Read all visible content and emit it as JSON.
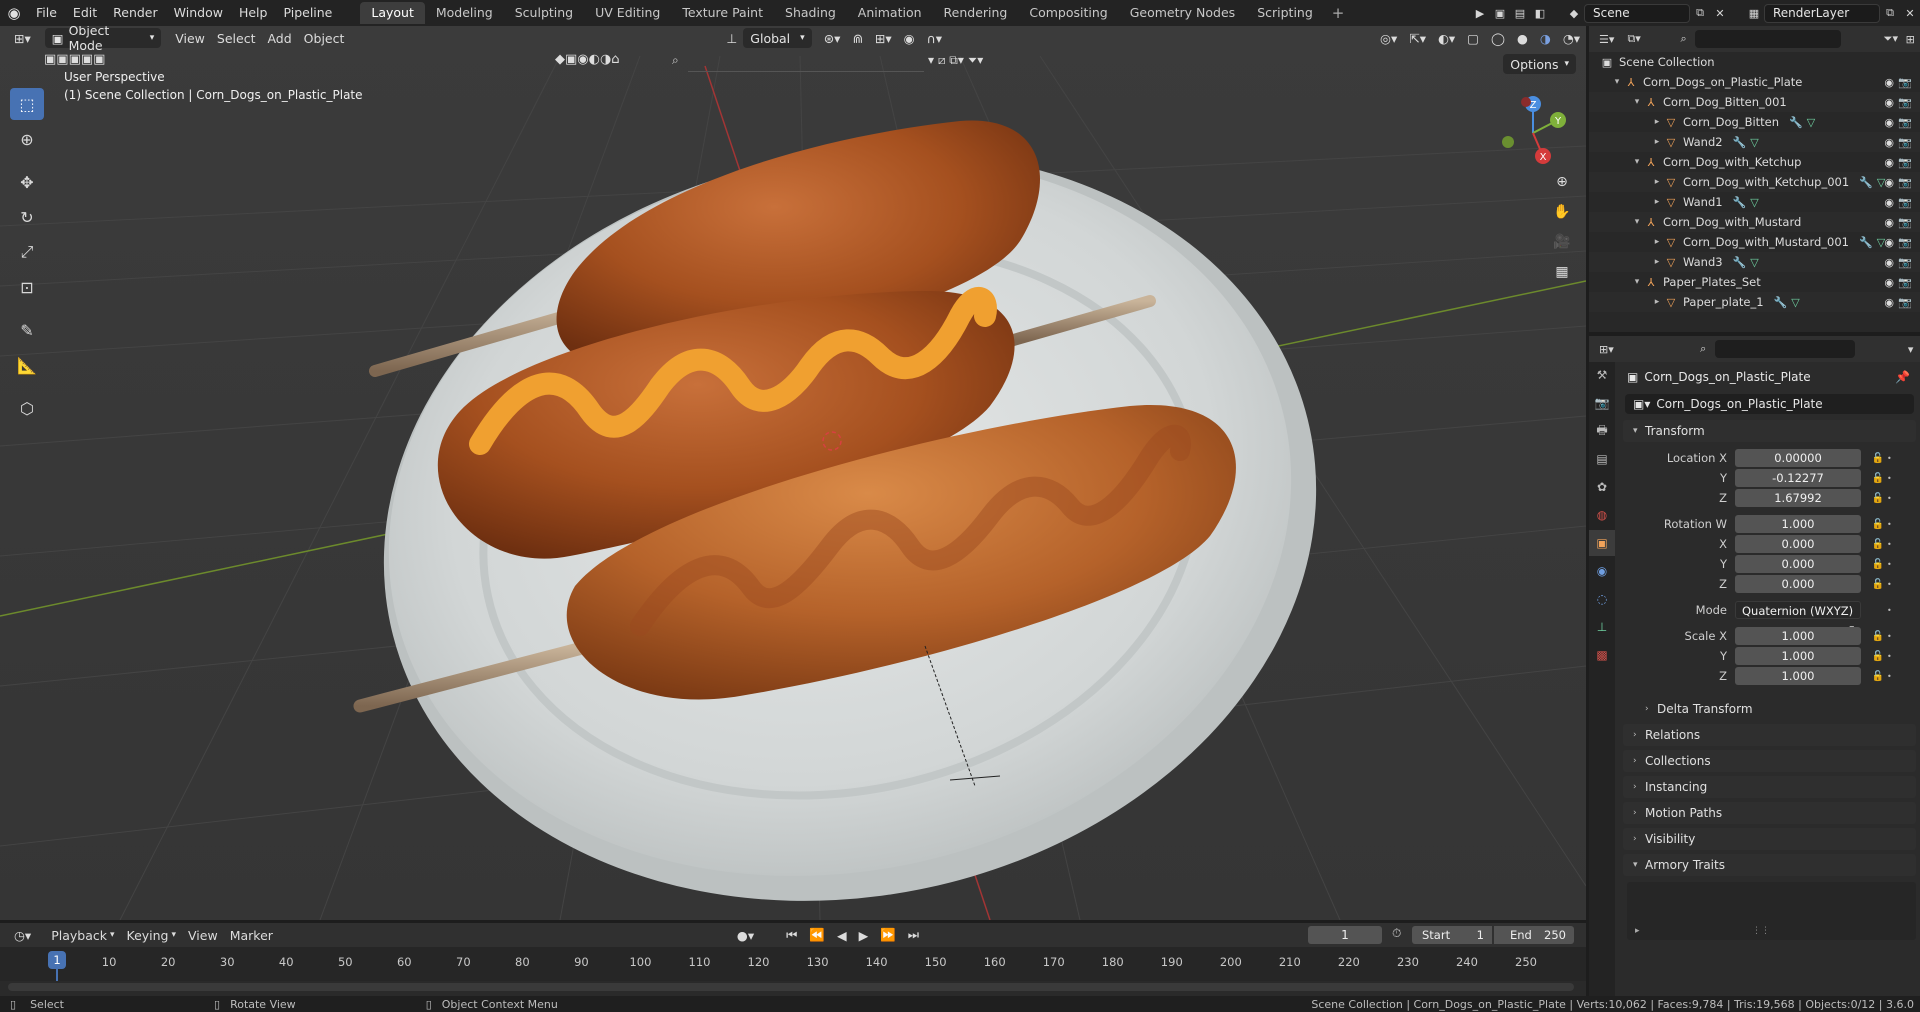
{
  "topbar": {
    "menus": [
      "File",
      "Edit",
      "Render",
      "Window",
      "Help",
      "Pipeline"
    ],
    "workspaces": [
      "Layout",
      "Modeling",
      "Sculpting",
      "UV Editing",
      "Texture Paint",
      "Shading",
      "Animation",
      "Rendering",
      "Compositing",
      "Geometry Nodes",
      "Scripting"
    ],
    "active_workspace": "Layout",
    "scene_name": "Scene",
    "view_layer": "RenderLayer"
  },
  "viewport": {
    "mode": "Object Mode",
    "menus": [
      "View",
      "Select",
      "Add",
      "Object"
    ],
    "transform_orientation": "Global",
    "options_label": "Options",
    "perspective_label": "User Perspective",
    "collection_label": "(1) Scene Collection | Corn_Dogs_on_Plastic_Plate",
    "gizmo_axes": {
      "x": "X",
      "y": "Y",
      "z": "Z"
    }
  },
  "outliner": {
    "root": "Scene Collection",
    "items": [
      {
        "label": "Corn_Dogs_on_Plastic_Plate",
        "depth": 0,
        "type": "empty",
        "expanded": true
      },
      {
        "label": "Corn_Dog_Bitten_001",
        "depth": 1,
        "type": "empty",
        "expanded": true
      },
      {
        "label": "Corn_Dog_Bitten",
        "depth": 2,
        "type": "mesh",
        "expanded": false
      },
      {
        "label": "Wand2",
        "depth": 2,
        "type": "mesh",
        "expanded": false
      },
      {
        "label": "Corn_Dog_with_Ketchup",
        "depth": 1,
        "type": "empty",
        "expanded": true
      },
      {
        "label": "Corn_Dog_with_Ketchup_001",
        "depth": 2,
        "type": "mesh",
        "expanded": false
      },
      {
        "label": "Wand1",
        "depth": 2,
        "type": "mesh",
        "expanded": false
      },
      {
        "label": "Corn_Dog_with_Mustard",
        "depth": 1,
        "type": "empty",
        "expanded": true
      },
      {
        "label": "Corn_Dog_with_Mustard_001",
        "depth": 2,
        "type": "mesh",
        "expanded": false
      },
      {
        "label": "Wand3",
        "depth": 2,
        "type": "mesh",
        "expanded": false
      },
      {
        "label": "Paper_Plates_Set",
        "depth": 1,
        "type": "empty",
        "expanded": true
      },
      {
        "label": "Paper_plate_1",
        "depth": 2,
        "type": "mesh",
        "expanded": false
      }
    ]
  },
  "properties": {
    "object_title": "Corn_Dogs_on_Plastic_Plate",
    "object_name": "Corn_Dogs_on_Plastic_Plate",
    "transform_label": "Transform",
    "location": {
      "label": "Location X",
      "x": "0.00000",
      "y": "-0.12277",
      "z": "1.67992"
    },
    "rotation": {
      "label": "Rotation W",
      "w": "1.000",
      "x": "0.000",
      "y": "0.000",
      "z": "0.000"
    },
    "mode_label": "Mode",
    "mode_value": "Quaternion (WXYZ)",
    "scale": {
      "label": "Scale X",
      "x": "1.000",
      "y": "1.000",
      "z": "1.000"
    },
    "axis_labels": {
      "y": "Y",
      "z": "Z",
      "x": "X"
    },
    "delta_transform": "Delta Transform",
    "panels": [
      "Relations",
      "Collections",
      "Instancing",
      "Motion Paths",
      "Visibility"
    ],
    "armory_traits": "Armory Traits"
  },
  "timeline": {
    "menus": [
      "Playback",
      "Keying",
      "View",
      "Marker"
    ],
    "current_frame": "1",
    "start_label": "Start",
    "start_value": "1",
    "end_label": "End",
    "end_value": "250",
    "ticks": [
      "10",
      "20",
      "30",
      "40",
      "50",
      "60",
      "70",
      "80",
      "90",
      "100",
      "110",
      "120",
      "130",
      "140",
      "150",
      "160",
      "170",
      "180",
      "190",
      "200",
      "210",
      "220",
      "230",
      "240",
      "250"
    ],
    "playhead": "1"
  },
  "statusbar": {
    "select": "Select",
    "rotate": "Rotate View",
    "context": "Object Context Menu",
    "stats": "Scene Collection | Corn_Dogs_on_Plastic_Plate | Verts:10,062 | Faces:9,784 | Tris:19,568 | Objects:0/12 | 3.6.0"
  },
  "colors": {
    "accent": "#4772b3",
    "object_orange": "#f2a35a",
    "mustard": "#f0a030",
    "plate": "#d8dcdc"
  }
}
